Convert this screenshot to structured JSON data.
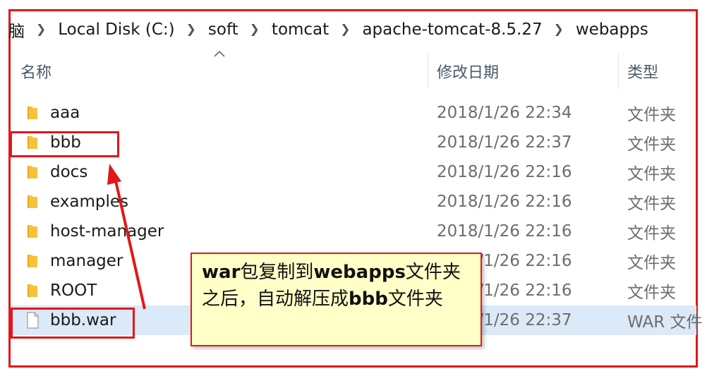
{
  "breadcrumb": {
    "items": [
      "脑",
      "Local Disk (C:)",
      "soft",
      "tomcat",
      "apache-tomcat-8.5.27",
      "webapps"
    ]
  },
  "columns": {
    "name": "名称",
    "modified": "修改日期",
    "type": "类型"
  },
  "files": [
    {
      "name": "aaa",
      "modified": "2018/1/26 22:34",
      "type": "文件夹",
      "icon": "folder-icon"
    },
    {
      "name": "bbb",
      "modified": "2018/1/26 22:37",
      "type": "文件夹",
      "icon": "folder-icon"
    },
    {
      "name": "docs",
      "modified": "2018/1/26 22:16",
      "type": "文件夹",
      "icon": "folder-icon"
    },
    {
      "name": "examples",
      "modified": "2018/1/26 22:16",
      "type": "文件夹",
      "icon": "folder-icon"
    },
    {
      "name": "host-manager",
      "modified": "2018/1/26 22:16",
      "type": "文件夹",
      "icon": "folder-icon"
    },
    {
      "name": "manager",
      "modified": "2018/1/26 22:16",
      "type": "文件夹",
      "icon": "folder-icon"
    },
    {
      "name": "ROOT",
      "modified": "2018/1/26 22:16",
      "type": "文件夹",
      "icon": "folder-icon"
    },
    {
      "name": "bbb.war",
      "modified": "2018/1/26 22:37",
      "type": "WAR 文件",
      "icon": "file-icon"
    }
  ],
  "selected_file": "bbb.war",
  "annotation": {
    "segments": [
      {
        "text": "war",
        "bold": true
      },
      {
        "text": "包复制到",
        "bold": false
      },
      {
        "text": "webapps",
        "bold": true
      },
      {
        "text": "文件夹之后，自动解压成",
        "bold": false
      },
      {
        "text": "bbb",
        "bold": true
      },
      {
        "text": "文件夹",
        "bold": false
      }
    ]
  },
  "colors": {
    "annotation_red": "#e0181b",
    "callout_bg": "#ffffc8",
    "selection_bg": "#dbe9f8",
    "folder_yellow": "#f5c33b"
  }
}
